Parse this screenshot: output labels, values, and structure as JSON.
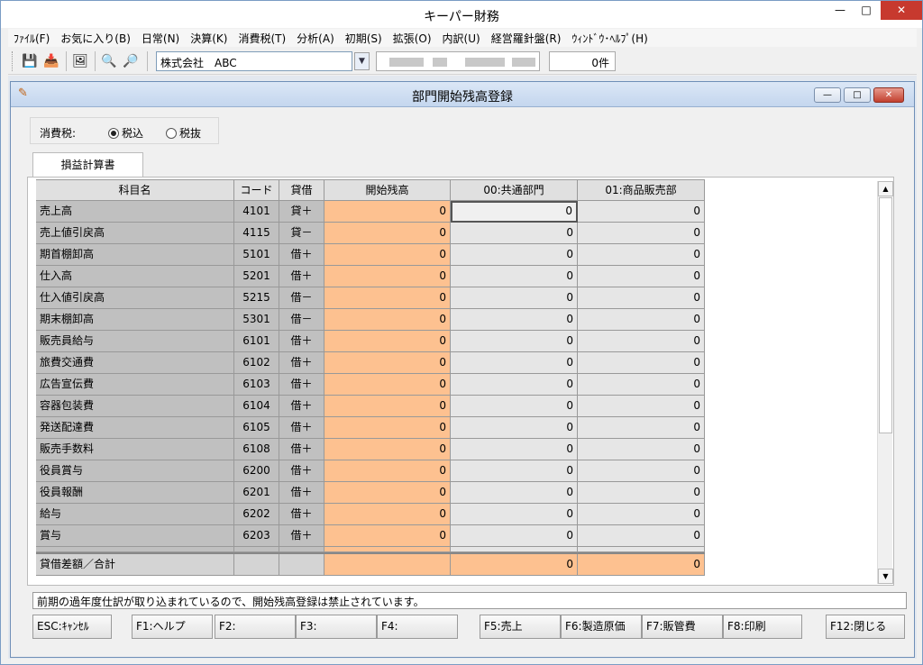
{
  "window": {
    "title": "キーパー財務"
  },
  "menu": [
    "ﾌｧｲﾙ(F)",
    "お気に入り(B)",
    "日常(N)",
    "決算(K)",
    "消費税(T)",
    "分析(A)",
    "初期(S)",
    "拡張(O)",
    "内訳(U)",
    "経営羅針盤(R)",
    "ｳｨﾝﾄﾞｳ･ﾍﾙﾌﾟ(H)"
  ],
  "toolbar": {
    "company": "株式会社　ABC",
    "count": "0件"
  },
  "child": {
    "title": "部門開始残高登録"
  },
  "tax": {
    "label": "消費税:",
    "options": [
      "税込",
      "税抜"
    ],
    "selected": "税込"
  },
  "tab": {
    "label": "損益計算書"
  },
  "grid": {
    "headers": [
      "科目名",
      "コード",
      "貸借",
      "開始残高",
      "00:共通部門",
      "01:商品販売部"
    ],
    "rows": [
      {
        "name": "売上高",
        "code": "4101",
        "dc": "貸＋",
        "start": "0",
        "d00": "0",
        "d01": "0"
      },
      {
        "name": "売上値引戻高",
        "code": "4115",
        "dc": "貸－",
        "start": "0",
        "d00": "0",
        "d01": "0"
      },
      {
        "name": "期首棚卸高",
        "code": "5101",
        "dc": "借＋",
        "start": "0",
        "d00": "0",
        "d01": "0"
      },
      {
        "name": "仕入高",
        "code": "5201",
        "dc": "借＋",
        "start": "0",
        "d00": "0",
        "d01": "0"
      },
      {
        "name": "仕入値引戻高",
        "code": "5215",
        "dc": "借－",
        "start": "0",
        "d00": "0",
        "d01": "0"
      },
      {
        "name": "期末棚卸高",
        "code": "5301",
        "dc": "借－",
        "start": "0",
        "d00": "0",
        "d01": "0"
      },
      {
        "name": "販売員給与",
        "code": "6101",
        "dc": "借＋",
        "start": "0",
        "d00": "0",
        "d01": "0"
      },
      {
        "name": "旅費交通費",
        "code": "6102",
        "dc": "借＋",
        "start": "0",
        "d00": "0",
        "d01": "0"
      },
      {
        "name": "広告宣伝費",
        "code": "6103",
        "dc": "借＋",
        "start": "0",
        "d00": "0",
        "d01": "0"
      },
      {
        "name": "容器包装費",
        "code": "6104",
        "dc": "借＋",
        "start": "0",
        "d00": "0",
        "d01": "0"
      },
      {
        "name": "発送配達費",
        "code": "6105",
        "dc": "借＋",
        "start": "0",
        "d00": "0",
        "d01": "0"
      },
      {
        "name": "販売手数料",
        "code": "6108",
        "dc": "借＋",
        "start": "0",
        "d00": "0",
        "d01": "0"
      },
      {
        "name": "役員賞与",
        "code": "6200",
        "dc": "借＋",
        "start": "0",
        "d00": "0",
        "d01": "0"
      },
      {
        "name": "役員報酬",
        "code": "6201",
        "dc": "借＋",
        "start": "0",
        "d00": "0",
        "d01": "0"
      },
      {
        "name": "給与",
        "code": "6202",
        "dc": "借＋",
        "start": "0",
        "d00": "0",
        "d01": "0"
      },
      {
        "name": "賞与",
        "code": "6203",
        "dc": "借＋",
        "start": "0",
        "d00": "0",
        "d01": "0"
      }
    ],
    "total": {
      "name": "貸借差額／合計",
      "d00": "0",
      "d01": "0"
    }
  },
  "message": "前期の過年度仕訳が取り込まれているので、開始残高登録は禁止されています。",
  "fkeys": [
    "ESC:ｷｬﾝｾﾙ",
    "F1:ヘルプ",
    "F2:",
    "F3:",
    "F4:",
    "F5:売上",
    "F6:製造原価",
    "F7:販管費",
    "F8:印刷",
    "F12:閉じる"
  ]
}
